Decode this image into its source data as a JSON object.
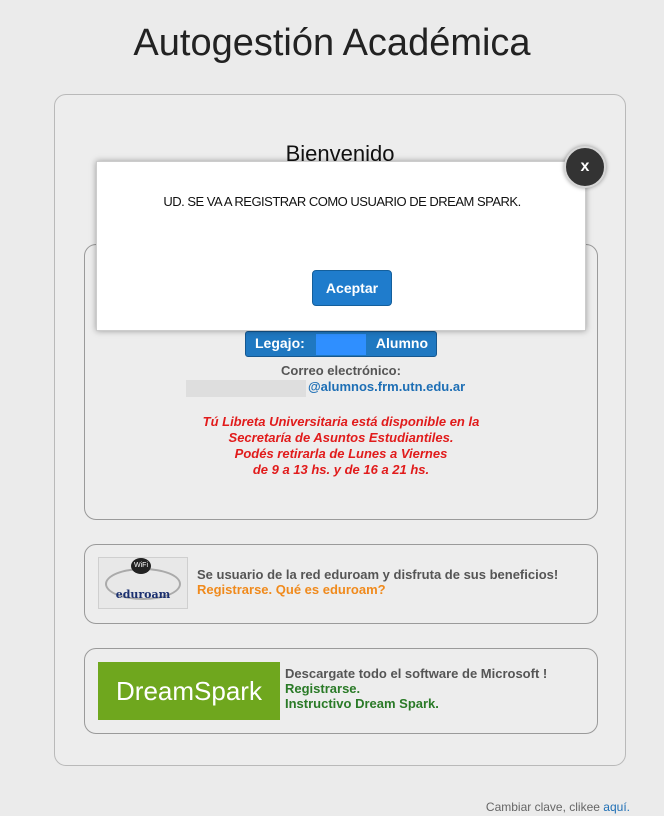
{
  "page": {
    "title": "Autogestión Académica",
    "welcome": "Bienvenido"
  },
  "student": {
    "legajo_label": "Legajo:",
    "role": "Alumno",
    "email_label": "Correo electrónico:",
    "email_domain": "@alumnos.frm.utn.edu.ar",
    "notice_lines": [
      "Tú Libreta Universitaria está disponible en la",
      "Secretaría de Asuntos Estudiantiles.",
      "Podés retirarla de Lunes a Viernes",
      "de 9 a 13 hs. y de 16 a 21 hs."
    ]
  },
  "eduroam": {
    "logo_text": "eduroam",
    "logo_badge": "WiFi",
    "text": "Se usuario de la red eduroam y disfruta de sus beneficios!",
    "register_link": "Registrarse.",
    "info_link": "Qué es eduroam?"
  },
  "dreamspark": {
    "logo_text": "DreamSpark",
    "text": "Descargate todo el software de Microsoft !",
    "register_link": "Registrarse.",
    "guide_link": "Instructivo Dream Spark."
  },
  "footer": {
    "text": "Cambiar clave, clikee",
    "link": "aquí."
  },
  "modal": {
    "message": "UD. SE VA A REGISTRAR COMO USUARIO DE DREAM SPARK.",
    "accept_label": "Aceptar",
    "close_label": "x"
  },
  "colors": {
    "accent_blue": "#1f7ccc",
    "notice_red": "#e11b1b",
    "link_orange": "#f08a1c",
    "link_green": "#2a7a27",
    "dreamspark_green": "#6fa71e"
  }
}
